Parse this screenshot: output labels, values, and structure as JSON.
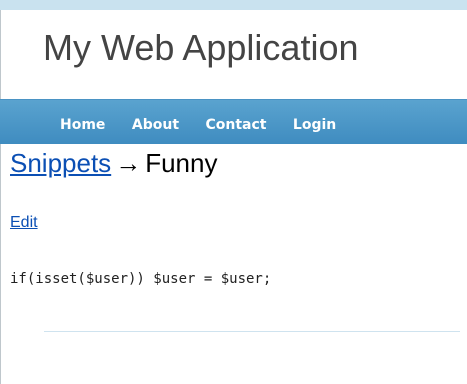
{
  "header": {
    "title": "My Web Application"
  },
  "nav": {
    "items": [
      {
        "label": "Home"
      },
      {
        "label": "About"
      },
      {
        "label": "Contact"
      },
      {
        "label": "Login"
      }
    ]
  },
  "breadcrumb": {
    "parent": "Snippets",
    "separator": "→",
    "current": "Funny"
  },
  "actions": {
    "edit_label": "Edit"
  },
  "snippet": {
    "code": "if(isset($user)) $user = $user;"
  },
  "colors": {
    "accent": "#4a98c9",
    "link": "#0b4fb4",
    "title": "#444444"
  }
}
